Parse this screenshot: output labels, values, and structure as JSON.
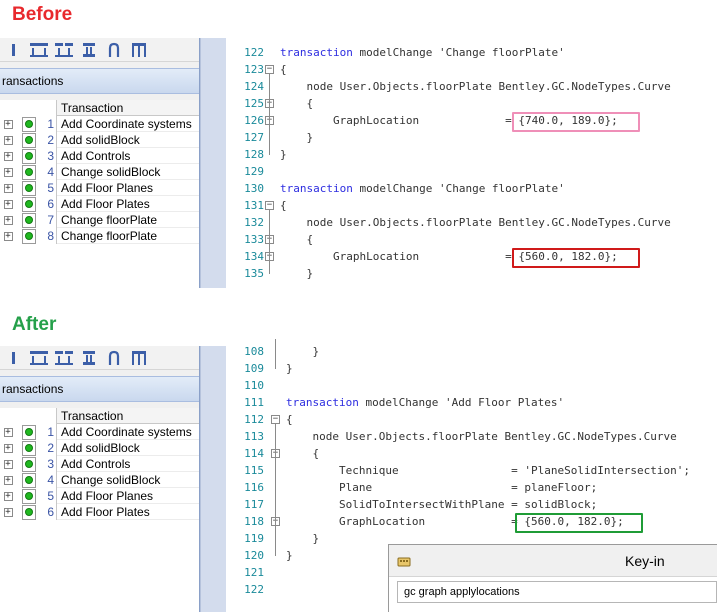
{
  "headings": {
    "before": "Before",
    "after": "After"
  },
  "colors": {
    "before": "#e8292d",
    "after": "#25a04a",
    "box_pink": "#ef8fb8",
    "box_red": "#d01a1a",
    "box_green": "#1f9c36"
  },
  "panel": {
    "title": "ransactions",
    "column_header": "Transaction"
  },
  "before_transactions": [
    {
      "num": "1",
      "label": "Add Coordinate systems"
    },
    {
      "num": "2",
      "label": "Add solidBlock"
    },
    {
      "num": "3",
      "label": "Add Controls"
    },
    {
      "num": "4",
      "label": "Change solidBlock"
    },
    {
      "num": "5",
      "label": "Add Floor Planes"
    },
    {
      "num": "6",
      "label": "Add Floor Plates"
    },
    {
      "num": "7",
      "label": "Change floorPlate"
    },
    {
      "num": "8",
      "label": "Change floorPlate"
    }
  ],
  "after_transactions": [
    {
      "num": "1",
      "label": "Add Coordinate systems"
    },
    {
      "num": "2",
      "label": "Add solidBlock"
    },
    {
      "num": "3",
      "label": "Add Controls"
    },
    {
      "num": "4",
      "label": "Change solidBlock"
    },
    {
      "num": "5",
      "label": "Add Floor Planes"
    },
    {
      "num": "6",
      "label": "Add Floor Plates"
    }
  ],
  "before_code": [
    {
      "n": "122",
      "text": "transaction modelChange 'Change floorPlate'"
    },
    {
      "n": "123",
      "text": "{"
    },
    {
      "n": "124",
      "text": "    node User.Objects.floorPlate Bentley.GC.NodeTypes.Curve"
    },
    {
      "n": "125",
      "text": "    {"
    },
    {
      "n": "126",
      "text": "        GraphLocation             = {740.0, 189.0};"
    },
    {
      "n": "127",
      "text": "    }"
    },
    {
      "n": "128",
      "text": "}"
    },
    {
      "n": "129",
      "text": ""
    },
    {
      "n": "130",
      "text": "transaction modelChange 'Change floorPlate'"
    },
    {
      "n": "131",
      "text": "{"
    },
    {
      "n": "132",
      "text": "    node User.Objects.floorPlate Bentley.GC.NodeTypes.Curve"
    },
    {
      "n": "133",
      "text": "    {"
    },
    {
      "n": "134",
      "text": "        GraphLocation             = {560.0, 182.0};"
    },
    {
      "n": "135",
      "text": "    }"
    }
  ],
  "after_code": [
    {
      "n": "108",
      "text": "    }"
    },
    {
      "n": "109",
      "text": "}"
    },
    {
      "n": "110",
      "text": ""
    },
    {
      "n": "111",
      "text": "transaction modelChange 'Add Floor Plates'"
    },
    {
      "n": "112",
      "text": "{"
    },
    {
      "n": "113",
      "text": "    node User.Objects.floorPlate Bentley.GC.NodeTypes.Curve"
    },
    {
      "n": "114",
      "text": "    {"
    },
    {
      "n": "115",
      "text": "        Technique                 = 'PlaneSolidIntersection';"
    },
    {
      "n": "116",
      "text": "        Plane                     = planeFloor;"
    },
    {
      "n": "117",
      "text": "        SolidToIntersectWithPlane = solidBlock;"
    },
    {
      "n": "118",
      "text": "        GraphLocation             = {560.0, 182.0};"
    },
    {
      "n": "119",
      "text": "    }"
    },
    {
      "n": "120",
      "text": "}"
    },
    {
      "n": "121",
      "text": ""
    },
    {
      "n": "122",
      "text": ""
    }
  ],
  "keyin": {
    "title": "Key-in",
    "input_value": "gc graph applylocations"
  }
}
